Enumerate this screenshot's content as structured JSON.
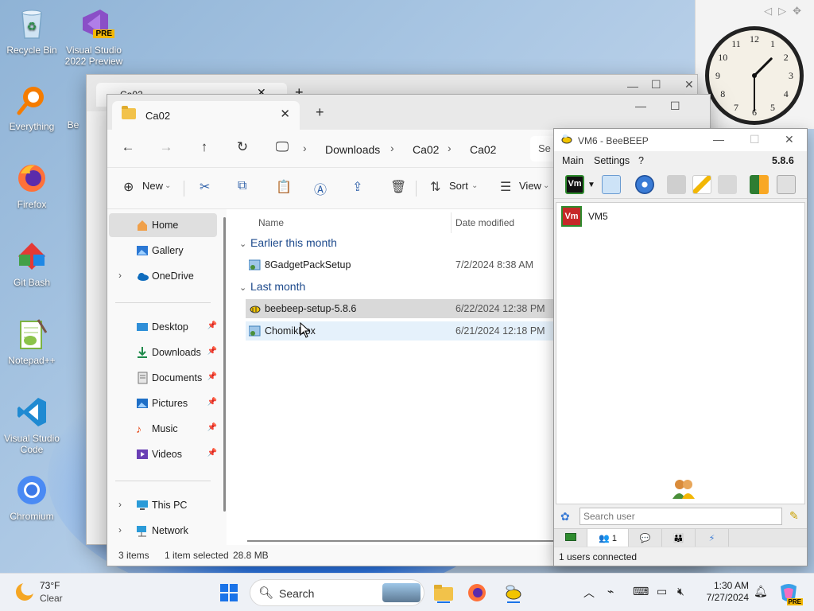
{
  "desktop": {
    "icons": [
      {
        "label": "Recycle Bin"
      },
      {
        "label": "Visual Studio 2022 Preview",
        "badge": "PRE"
      },
      {
        "label": "Everything"
      },
      {
        "label": "Firefox"
      },
      {
        "label": "Git Bash"
      },
      {
        "label": "Notepad++"
      },
      {
        "label": "Visual Studio Code"
      },
      {
        "label": "Chromium"
      }
    ],
    "partial_icon_label": "Be"
  },
  "gadget": {
    "clock": {
      "hours": [
        "12",
        "1",
        "2",
        "3",
        "4",
        "5",
        "6",
        "7",
        "8",
        "9",
        "10",
        "11"
      ],
      "hour": 1,
      "minute": 30
    }
  },
  "back_window": {
    "tab_title": "Ca02"
  },
  "explorer": {
    "tab_title": "Ca02",
    "new_tab": "+",
    "breadcrumb": [
      "Downloads",
      "Ca02",
      "Ca02"
    ],
    "search_placeholder": "Se",
    "toolbar": {
      "new_label": "New",
      "sort_label": "Sort",
      "view_label": "View"
    },
    "nav": {
      "home": "Home",
      "gallery": "Gallery",
      "onedrive": "OneDrive",
      "quick": [
        "Desktop",
        "Downloads",
        "Documents",
        "Pictures",
        "Music",
        "Videos"
      ],
      "this_pc": "This PC",
      "network": "Network"
    },
    "columns": {
      "name": "Name",
      "date": "Date modified"
    },
    "groups": [
      {
        "title": "Earlier this month",
        "files": [
          {
            "name": "8GadgetPackSetup",
            "date": "7/2/2024 8:38 AM"
          }
        ]
      },
      {
        "title": "Last month",
        "files": [
          {
            "name": "beebeep-setup-5.8.6",
            "date": "6/22/2024 12:38 PM"
          },
          {
            "name": "ChomikBox",
            "date": "6/21/2024 12:18 PM"
          }
        ]
      }
    ],
    "status": {
      "items": "3 items",
      "selected": "1 item selected",
      "size": "28.8 MB"
    }
  },
  "beebeep": {
    "title": "VM6 - BeeBEEP",
    "menu": [
      "Main",
      "Settings",
      "?"
    ],
    "version": "5.8.6",
    "vm_badge": "Vm",
    "users": [
      {
        "name": "VM5"
      }
    ],
    "search_placeholder": "Search user",
    "tab_count": "1",
    "status": "1 users connected"
  },
  "taskbar": {
    "weather_temp": "73°F",
    "weather_desc": "Clear",
    "search_label": "Search",
    "time": "1:30 AM",
    "date": "7/27/2024",
    "copilot_badge": "PRE"
  },
  "colors": {
    "accent": "#1a73e8",
    "vm_red": "#c62828",
    "folder": "#f2c24a"
  }
}
